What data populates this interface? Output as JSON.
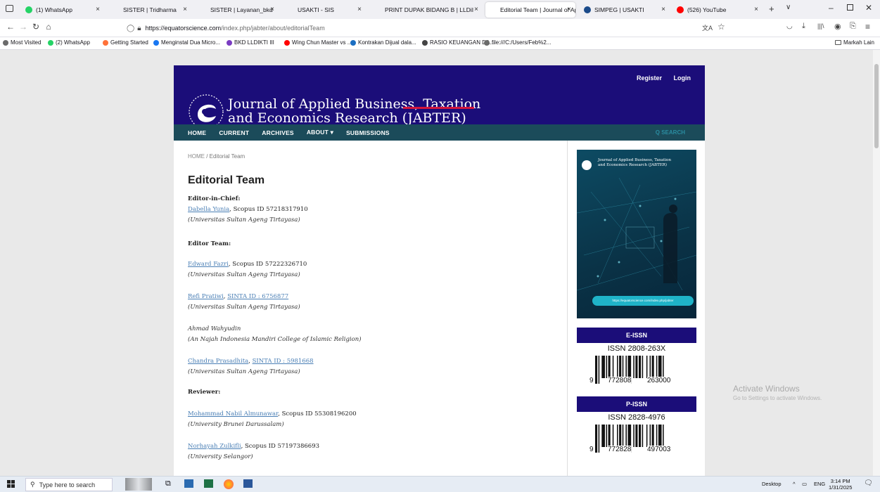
{
  "browser": {
    "tabs": [
      {
        "label": "(1) WhatsApp",
        "icon": "whatsapp-icon",
        "color": "#25d366"
      },
      {
        "label": "SISTER | Tridharma",
        "icon": "sister-icon",
        "color": "#f0f0f4"
      },
      {
        "label": "SISTER | Layanan_bkd",
        "icon": "sister-icon",
        "color": "#f0f0f4"
      },
      {
        "label": "USAKTI - SIS",
        "icon": "usakti-icon",
        "color": "#f0f0f4"
      },
      {
        "label": "PRINT DUPAK BIDANG B | LLDiI",
        "icon": "page-icon",
        "color": "#f0f0f4"
      },
      {
        "label": "Editorial Team | Journal of Appl",
        "icon": "page-icon",
        "color": "#ffffff"
      },
      {
        "label": "SIMPEG | USAKTI",
        "icon": "simpeg-icon",
        "color": "#1b4b8a"
      },
      {
        "label": "(526) YouTube",
        "icon": "youtube-icon",
        "color": "#ff0000"
      }
    ],
    "url_host": "https://equatorscience.com",
    "url_path": "/index.php/jabter/about/editorialTeam",
    "bookmarks": [
      {
        "label": "Most Visited",
        "color": "#6b6b6b"
      },
      {
        "label": "(2) WhatsApp",
        "color": "#25d366"
      },
      {
        "label": "Getting Started",
        "color": "#ff7139"
      },
      {
        "label": "Menginstal Dua Micro...",
        "color": "#1877f2"
      },
      {
        "label": "BKD LLDIKTI III",
        "color": "#7a3cc2"
      },
      {
        "label": "Wing Chun Master vs ...",
        "color": "#ff0000"
      },
      {
        "label": "Kontrakan Dijual dala...",
        "color": "#1b6ec2"
      },
      {
        "label": "RASIO KEUANGAN DA...",
        "color": "#444444"
      },
      {
        "label": "file:///C:/Users/Feb%2...",
        "color": "#6b6b6b"
      }
    ],
    "other_bookmarks": "Markah Lain"
  },
  "site": {
    "journal_title_line1": "Journal of Applied Business, Taxation",
    "journal_title_line2": "and Economics Research (JABTER)",
    "register": "Register",
    "login": "Login",
    "nav": [
      "HOME",
      "CURRENT",
      "ARCHIVES",
      "ABOUT ▾",
      "SUBMISSIONS"
    ],
    "search": "Q SEARCH",
    "breadcrumb_home": "HOME",
    "breadcrumb_sep": " / ",
    "breadcrumb_current": "Editorial Team",
    "page_title": "Editorial Team",
    "editor_in_chief_heading": "Editor-in-Chief:",
    "editor_team_heading": "Editor Team:",
    "reviewer_heading": "Reviewer:",
    "people": [
      {
        "name": "Dabella Yunia",
        "id": ", Scopus ID 57218317910",
        "affil": "(Universitas Sultan Ageng Tirtayasa)"
      },
      {
        "name": "Edward Fazri",
        "id": ", Scopus ID 57222326710",
        "affil": "(Universitas Sultan Ageng Tirtayasa)"
      },
      {
        "name": "Refi Pratiwi",
        "sep": ", ",
        "sinta": "SINTA ID : 6756877",
        "affil": "(Universitas Sultan Ageng Tirtayasa)"
      },
      {
        "name": "Ahmad Wahyudin",
        "affil": "(An Najah Indonesia Mandiri College of Islamic Religion)"
      },
      {
        "name": "Chandra Prasadhita",
        "sep": ", ",
        "sinta": "SINTA ID : 5981668",
        "affil": "(Universitas Sultan Ageng Tirtayasa)"
      },
      {
        "name": "Mohammad Nabil Almunawar",
        "id": ", Scopus ID 55308196200",
        "affil": "(University Brunei Darussalam)"
      },
      {
        "name": "Norhayah Zulkifli",
        "id": ", Scopus ID 57197386693",
        "affil": "(University Selangor)"
      }
    ],
    "cover_title_line1": "Journal of Applied Business, Taxation",
    "cover_title_line2": "and Economics Research (JABTER)",
    "cover_url": "https://equatorscience.com/index.php/jabter",
    "eissn_label": "E-ISSN",
    "eissn_barcode_title": "ISSN 2808-263X",
    "eissn_digits": [
      "9",
      "772808",
      "263000"
    ],
    "pissn_label": "P-ISSN",
    "pissn_barcode_title": "ISSN 2828-4976",
    "pissn_digits": [
      "9",
      "772828",
      "497003"
    ],
    "brand_blue": "#1b0d79",
    "nav_teal": "#1b4b5a",
    "accent_red": "#d4163c"
  },
  "windows": {
    "activate_title": "Activate Windows",
    "activate_sub": "Go to Settings to activate Windows.",
    "search_placeholder": "Type here to search",
    "desktop": "Desktop",
    "lang": "ENG",
    "time": "3:14 PM",
    "date": "1/31/2025"
  }
}
